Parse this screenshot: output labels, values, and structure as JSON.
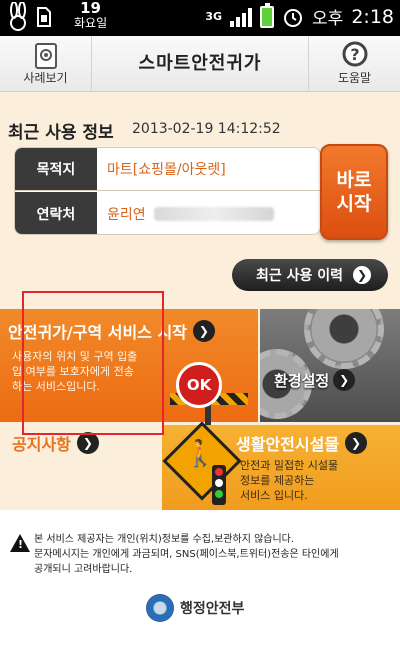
{
  "statusbar": {
    "date_num": "19",
    "weekday": "화요일",
    "net": "3G",
    "ampm": "오후",
    "time": "2:18",
    "icons": [
      "rabbit-icon",
      "sim-icon",
      "3g-icon",
      "signal-icon",
      "battery-icon",
      "alarm-icon"
    ]
  },
  "header": {
    "left_label": "사례보기",
    "title": "스마트안전귀가",
    "right_label": "도움말"
  },
  "recent": {
    "title": "최근 사용 정보",
    "datetime": "2013-02-19 14:12:52",
    "dest_label": "목적지",
    "dest_value": "마트[쇼핑몰/아웃렛]",
    "contact_label": "연락처",
    "contact_value": "윤리연"
  },
  "buttons": {
    "go": [
      "바로",
      "시작"
    ],
    "history": "최근 사용 이력"
  },
  "tiles": {
    "service_title": "안전귀가/구역 서비스 시작",
    "service_desc": "사용자의 위치 및 구역 입출입 여부를 보호자에게 전송하는 서비스입니다.",
    "ok_label": "OK",
    "settings_label": "환경설정",
    "notice_label": "공지사항",
    "life_title": "생활안전시설물",
    "life_desc": [
      "안전과 밀접한 시설물",
      "정보를 제공하는",
      "서비스 입니다."
    ]
  },
  "footer": {
    "notice_lines": [
      "본 서비스 제공자는 개인(위치)정보를 수집,보관하지 않습니다.",
      "문자메시지는 개인에게 과금되며, SNS(페이스북,트위터)전송은 타인에게",
      "공개되니 고려바랍니다."
    ],
    "ministry": "행정안전부"
  },
  "colors": {
    "accent": "#ee6b12",
    "highlight_box": "#e3262b"
  }
}
